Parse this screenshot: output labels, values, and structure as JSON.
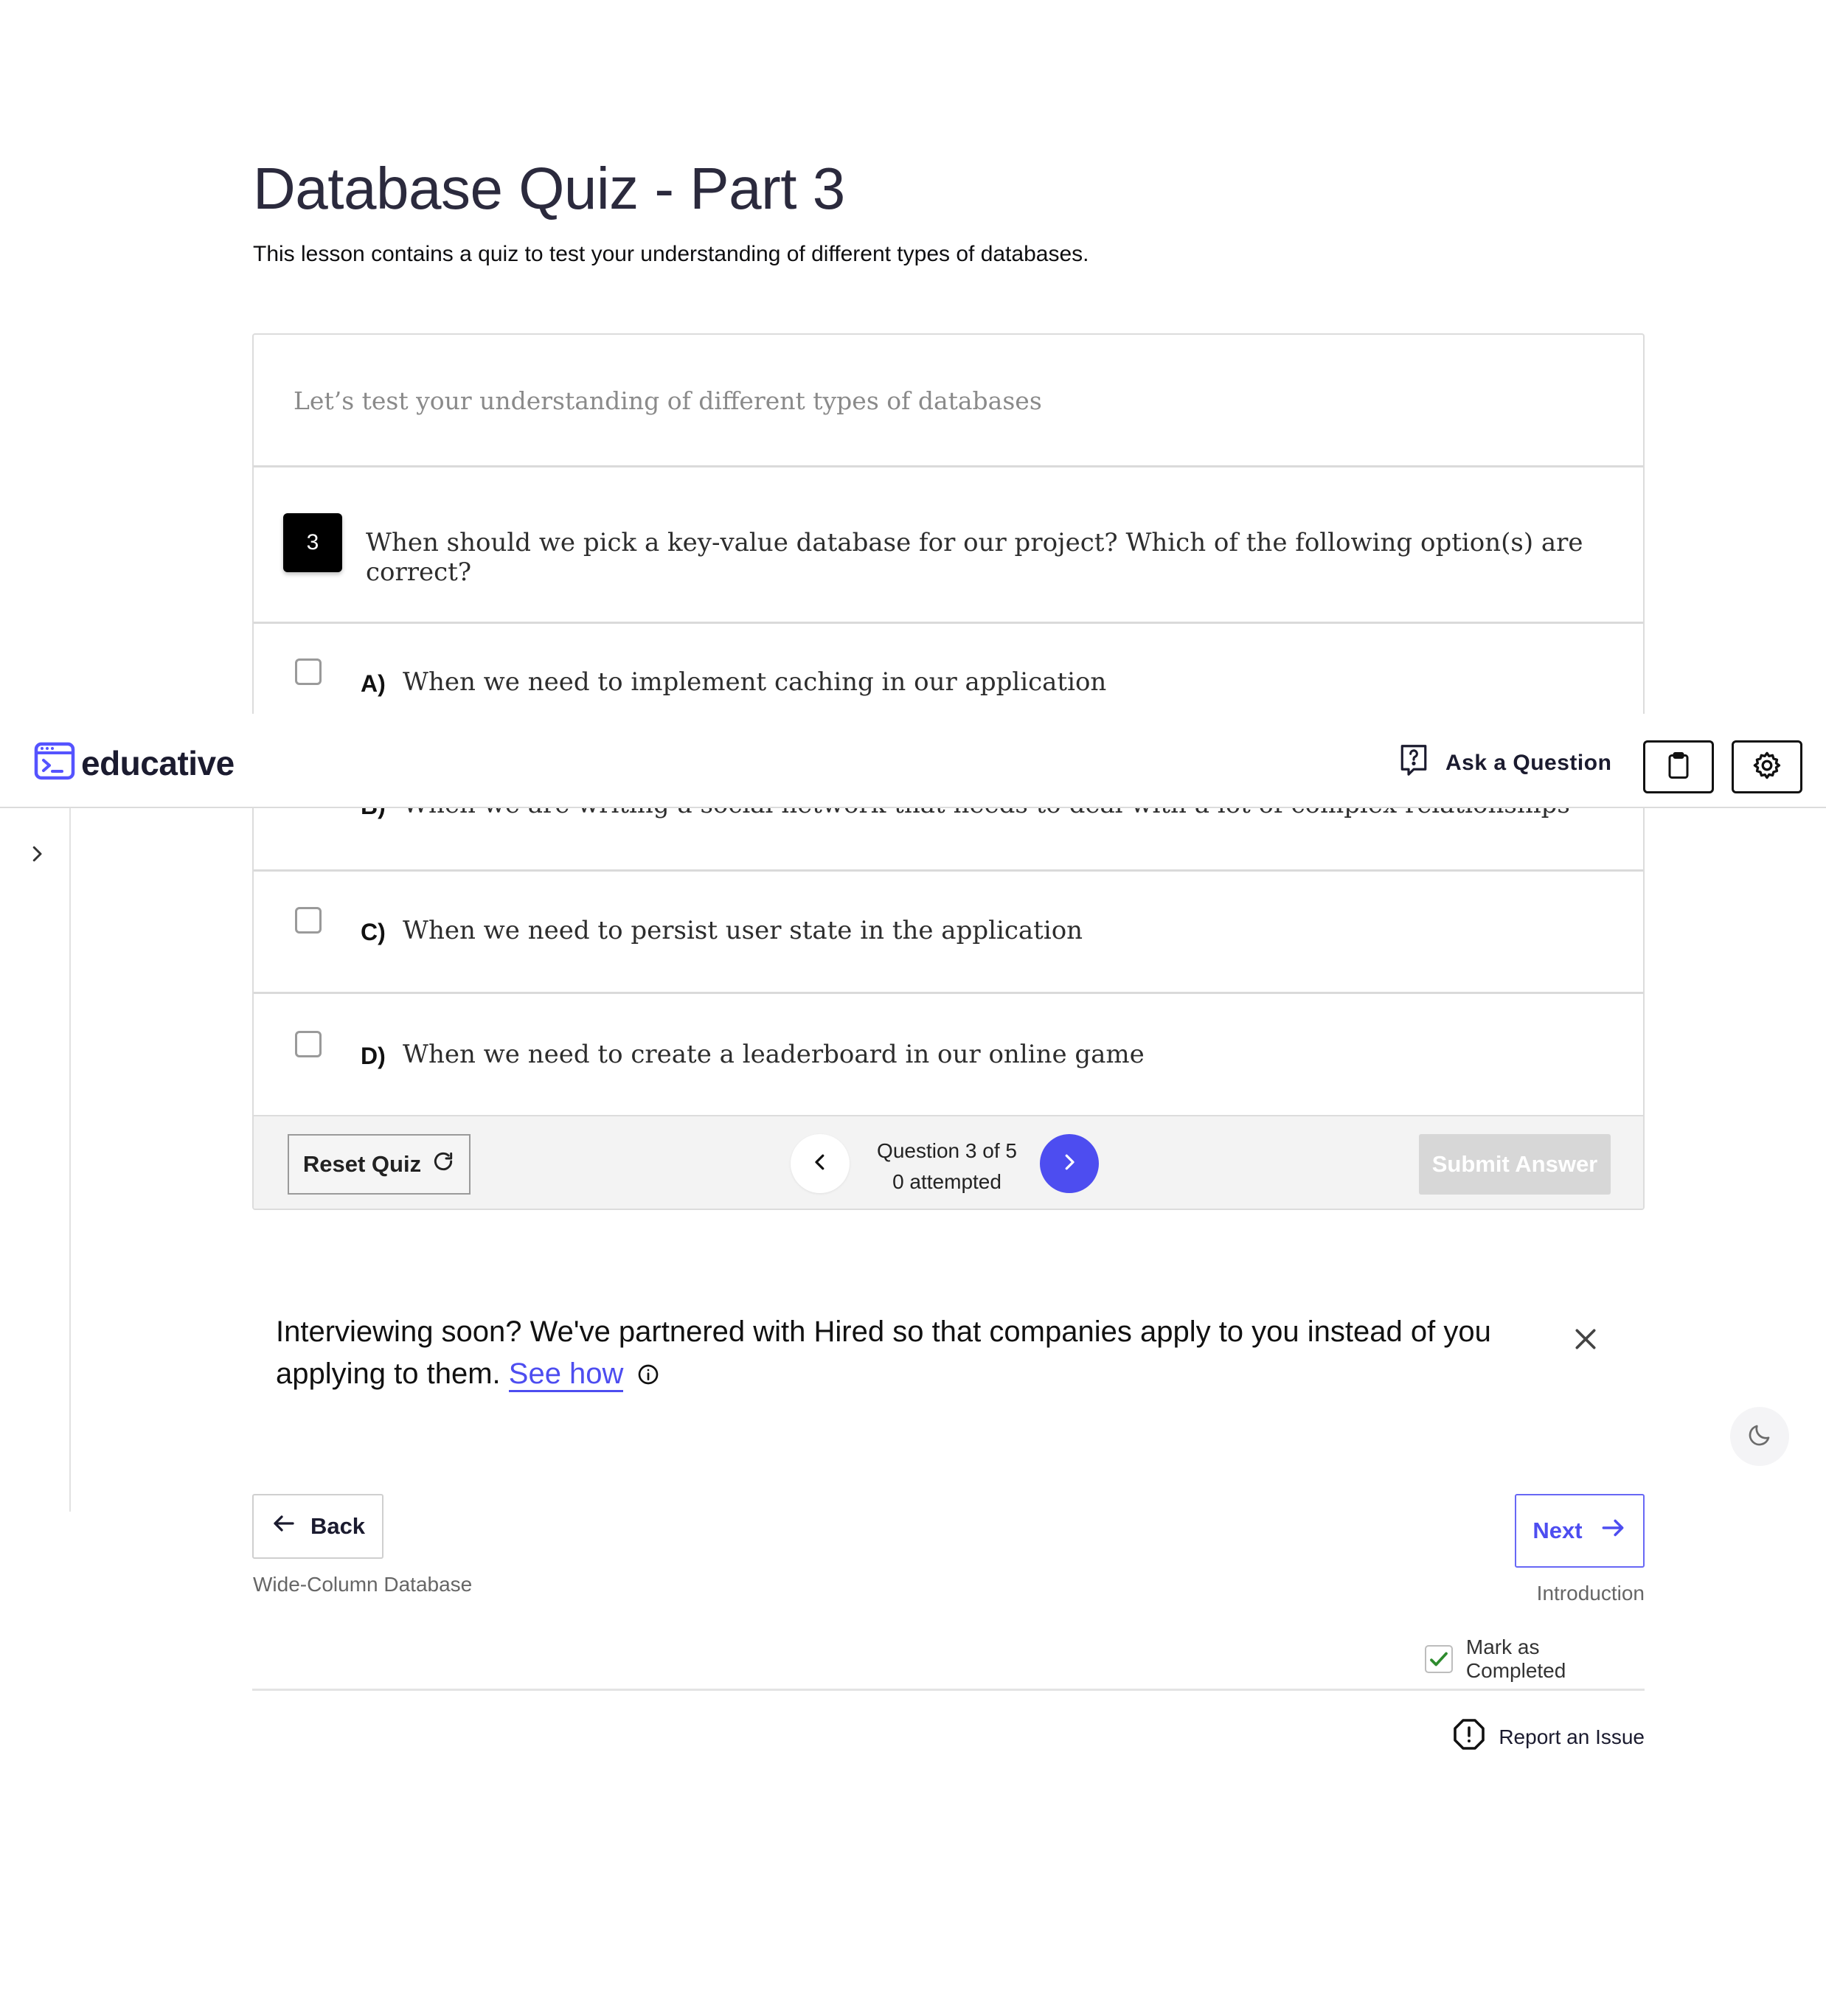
{
  "page": {
    "title": "Database Quiz - Part 3",
    "subtitle": "This lesson contains a quiz to test your understanding of different types of databases."
  },
  "quiz": {
    "intro": "Let’s test your understanding of different types of databases",
    "question_number": "3",
    "question_text": "When should we pick a key-value database for our project? Which of the following option(s) are correct?",
    "options": [
      {
        "letter": "A)",
        "text": "When we need to implement caching in our application",
        "checked": false
      },
      {
        "letter": "B)",
        "text": "When we are writing a social network that needs to deal with a lot of complex relationships",
        "checked": false
      },
      {
        "letter": "C)",
        "text": "When we need to persist user state in the application",
        "checked": false
      },
      {
        "letter": "D)",
        "text": "When we need to create a leaderboard in our online game",
        "checked": false
      }
    ],
    "footer": {
      "reset_label": "Reset Quiz",
      "progress_label": "Question 3 of 5",
      "attempted_label": "0 attempted",
      "submit_label": "Submit Answer"
    }
  },
  "topbar": {
    "logo_text": "educative",
    "ask_label": "Ask a Question"
  },
  "banner": {
    "text": "Interviewing soon? We've partnered with Hired so that companies apply to you instead of you applying to them.",
    "link_label": "See how"
  },
  "navigation": {
    "back_label": "Back",
    "back_sublabel": "Wide-Column Database",
    "next_label": "Next",
    "next_sublabel": "Introduction",
    "mark_completed_label": "Mark as Completed",
    "mark_completed_checked": true,
    "report_label": "Report an Issue"
  },
  "colors": {
    "accent": "#4d4df0",
    "title": "#2b2a3d",
    "check": "#2e8b2e"
  }
}
